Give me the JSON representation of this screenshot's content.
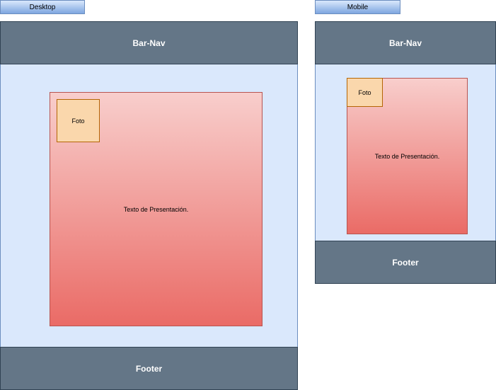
{
  "desktop": {
    "label": "Desktop",
    "navbar": "Bar-Nav",
    "photo": "Foto",
    "presentation": "Texto de Presentación.",
    "footer": "Footer"
  },
  "mobile": {
    "label": "Mobile",
    "navbar": "Bar-Nav",
    "photo": "Foto",
    "presentation": "Texto de Presentación.",
    "footer": "Footer"
  },
  "colors": {
    "bar": "#647687",
    "body": "#dae8fc",
    "card_top": "#f8cecc",
    "card_bottom": "#ea6b66",
    "photo": "#fad7ac",
    "tab_bottom": "#7ea6e0"
  }
}
